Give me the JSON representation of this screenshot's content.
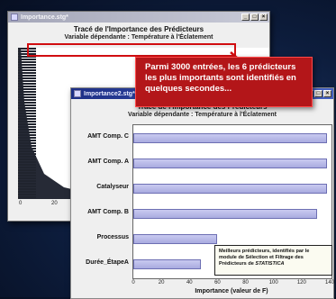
{
  "back_window": {
    "title": "Importance.stg*",
    "chart_title": "Tracé de l'Importance des Prédicteurs",
    "chart_subtitle": "Variable dépendante : Température à l'Éclatement",
    "x_ticks": [
      "0",
      "20"
    ]
  },
  "callout": {
    "text": "Parmi 3000 entrées, les 6 prédicteurs les plus importants sont identifiés en quelques secondes..."
  },
  "front_window": {
    "title": "Importance2.stg*",
    "chart_title": "Tracé de l'Importance des Prédicteurs",
    "chart_subtitle": "Variable dépendante : Température à l'Éclatement"
  },
  "note": {
    "line1": "Meilleurs prédicteurs, identifiés par le",
    "line2": "module de Sélection et Filtrage des",
    "line3_prefix": "Prédicteurs de ",
    "line3_em": "STATISTICA"
  },
  "colors": {
    "background": "#0d1d3d",
    "callout": "#b31619",
    "bar_fill": "#b7b9e8",
    "active_title": "#1d2f86"
  },
  "chart_data": {
    "type": "bar",
    "orientation": "horizontal",
    "categories": [
      "AMT Comp. C",
      "AMT Comp. A",
      "Catalyseur",
      "AMT Comp. B",
      "Processus",
      "Durée_ÉtapeA"
    ],
    "values": [
      138,
      138,
      138,
      131,
      60,
      48
    ],
    "xlabel": "Importance (valeur de F)",
    "ylabel": "",
    "xlim": [
      0,
      140
    ],
    "x_ticks": [
      "0",
      "20",
      "40",
      "60",
      "80",
      "100",
      "120",
      "140"
    ]
  }
}
